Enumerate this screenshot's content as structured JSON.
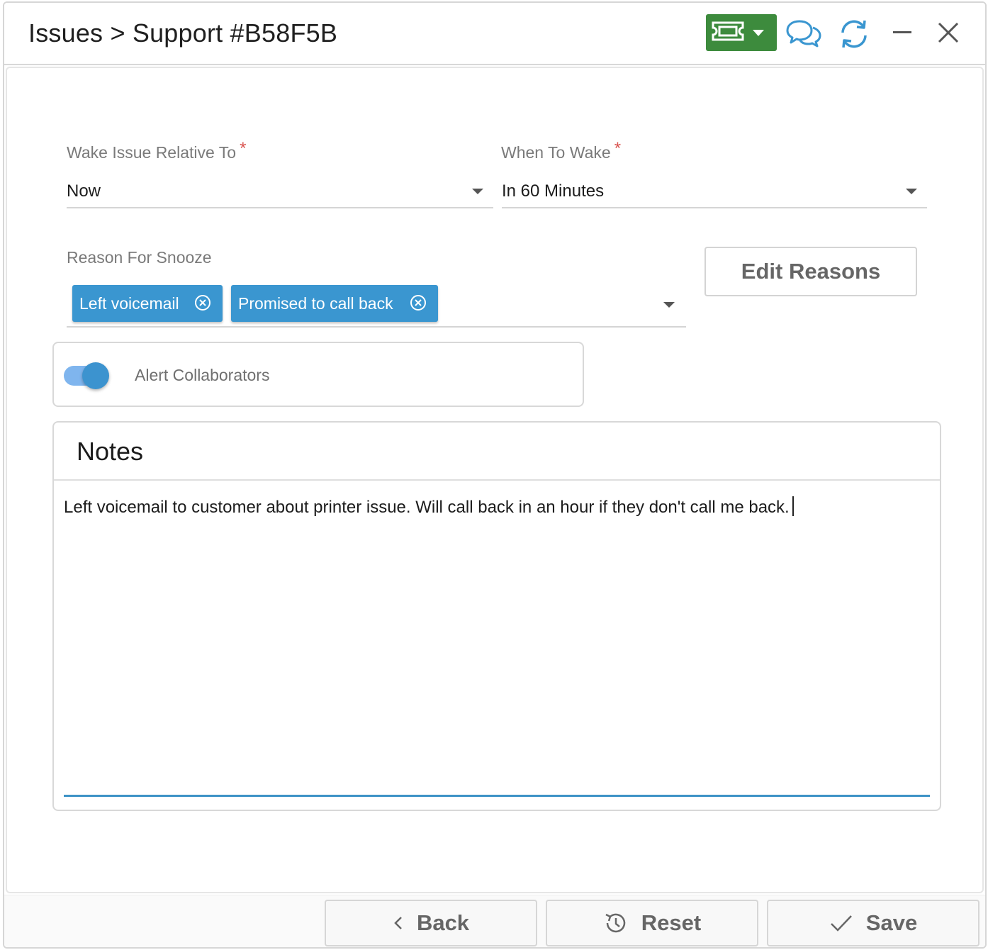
{
  "header": {
    "breadcrumb": "Issues > Support #B58F5B",
    "icons": [
      "ticket-icon",
      "chevron-down-icon",
      "chat-icon",
      "refresh-icon",
      "minimize-icon",
      "close-icon"
    ],
    "colors": {
      "ticket_button": "#3d8b3d",
      "accent": "#3a96d0"
    }
  },
  "form": {
    "wake_relative": {
      "label": "Wake Issue Relative To",
      "required_mark": "*",
      "value": "Now"
    },
    "when_to_wake": {
      "label": "When To Wake",
      "required_mark": "*",
      "value": "In 60 Minutes"
    },
    "reason": {
      "label": "Reason For Snooze",
      "chips": [
        "Left voicemail",
        "Promised to call back"
      ]
    },
    "edit_reasons_label": "Edit Reasons",
    "alert_collaborators": {
      "label": "Alert Collaborators",
      "enabled": true
    }
  },
  "notes": {
    "title": "Notes",
    "text": "Left voicemail to customer about printer issue. Will call back in an hour if they don't call me back."
  },
  "footer": {
    "back_label": "Back",
    "reset_label": "Reset",
    "save_label": "Save"
  }
}
